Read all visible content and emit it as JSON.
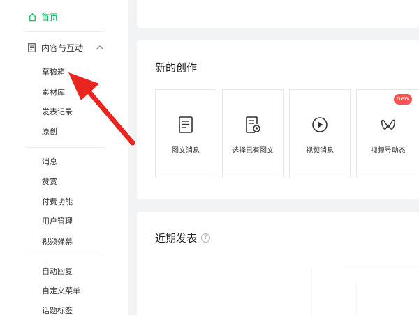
{
  "sidebar": {
    "home": "首页",
    "group": "内容与互动",
    "group_items": [
      "草稿箱",
      "素材库",
      "发表记录",
      "原创"
    ],
    "items2": [
      "消息",
      "赞赏",
      "付费功能",
      "用户管理",
      "视频弹幕"
    ],
    "items3": [
      "自动回复",
      "自定义菜单",
      "话题标签"
    ]
  },
  "main": {
    "create_title": "新的创作",
    "tiles": [
      {
        "label": "图文消息",
        "icon": "article-icon"
      },
      {
        "label": "选择已有图文",
        "icon": "existing-article-icon"
      },
      {
        "label": "视频消息",
        "icon": "play-icon"
      },
      {
        "label": "视频号动态",
        "icon": "channels-icon"
      }
    ],
    "new_badge": "new",
    "recent_title": "近期发表",
    "help_glyph": "?"
  },
  "colors": {
    "accent": "#07c160",
    "annotation_arrow": "#e8261f",
    "badge": "#fa5151"
  }
}
